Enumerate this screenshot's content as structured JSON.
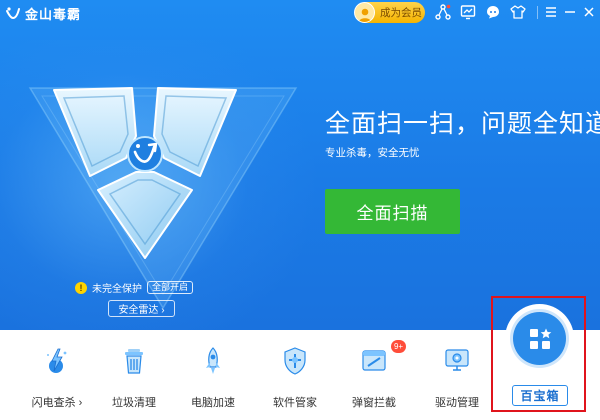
{
  "app": {
    "title": "金山毒霸"
  },
  "titlebar": {
    "vip_label": "成为会员",
    "icons": [
      "network-icon",
      "skin-icon",
      "chat-icon",
      "shirt-icon",
      "menu-icon",
      "minimize-icon",
      "close-icon"
    ]
  },
  "hero": {
    "headline": "全面扫一扫，问题全知道",
    "subline": "专业杀毒，安全无忧",
    "scan_button": "全面扫描",
    "status_text": "未完全保护",
    "enable_all": "全部开启",
    "radar_button": "安全雷达 ›",
    "warn_glyph": "!"
  },
  "tools": [
    {
      "label": "闪电查杀 ›",
      "icon": "lightning-scan-icon"
    },
    {
      "label": "垃圾清理",
      "icon": "trash-can-icon"
    },
    {
      "label": "电脑加速",
      "icon": "rocket-icon"
    },
    {
      "label": "软件管家",
      "icon": "software-shield-icon"
    },
    {
      "label": "弹窗拦截",
      "icon": "popup-block-icon",
      "badge": "9+"
    },
    {
      "label": "驱动管理",
      "icon": "driver-gear-icon"
    }
  ],
  "treasure": {
    "label": "百宝箱",
    "icon": "grid-star-icon"
  },
  "colors": {
    "hero_blue": "#1b7be6",
    "scan_green": "#34b836",
    "highlight_red": "#e0141c",
    "vip_gold": "#f5b400"
  }
}
